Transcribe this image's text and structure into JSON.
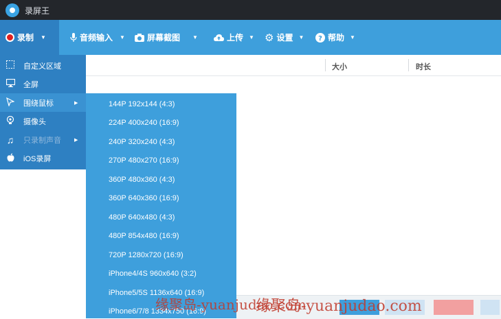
{
  "window": {
    "title": "录屏王"
  },
  "toolbar": {
    "record": "录制",
    "audio_input": "音频输入",
    "screenshot": "屏幕截图",
    "upload": "上传",
    "settings": "设置",
    "help": "帮助"
  },
  "table": {
    "columns": [
      "大小",
      "时长"
    ]
  },
  "record_menu": [
    {
      "label": "自定义区域",
      "icon": "dashed-square-icon"
    },
    {
      "label": "全屏",
      "icon": "monitor-icon"
    },
    {
      "label": "围绕鼠标",
      "icon": "cursor-icon",
      "has_submenu": true
    },
    {
      "label": "摄像头",
      "icon": "camera-icon"
    },
    {
      "label": "只录制声音",
      "icon": "music-note-icon",
      "has_submenu": true,
      "disabled": true
    },
    {
      "label": "iOS录屏",
      "icon": "apple-icon"
    }
  ],
  "mouse_submenu": [
    "144P 192x144 (4:3)",
    "224P 400x240 (16:9)",
    "240P 320x240 (4:3)",
    "270P 480x270 (16:9)",
    "360P 480x360 (4:3)",
    "360P 640x360 (16:9)",
    "480P 640x480 (4:3)",
    "480P 854x480 (16:9)",
    "720P 1280x720 (16:9)",
    "iPhone4/4S 960x640 (3:2)",
    "iPhone5/5S 1136x640 (16:9)",
    "iPhone6/7/8 1334x750 (16:9)"
  ],
  "watermark": {
    "text1": "缘聚岛-yuanjudao.com",
    "text2": "缘聚岛-yuanjudao.com"
  },
  "colors": {
    "title_bar": "#23262b",
    "toolbar": "#3e9fdc",
    "menu": "#2e80c2",
    "submenu": "#3e9fdc",
    "record_dot": "#e02020"
  }
}
